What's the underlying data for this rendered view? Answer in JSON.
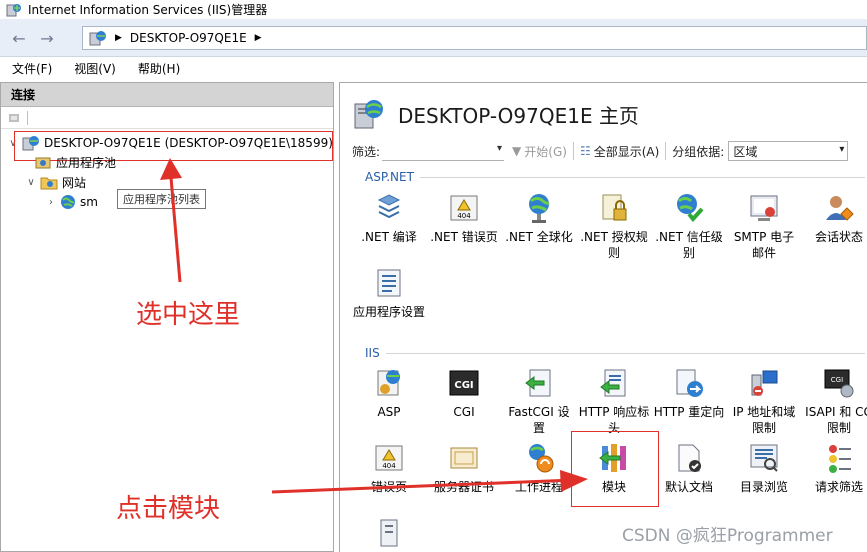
{
  "window": {
    "title": "Internet Information Services (IIS)管理器"
  },
  "address": {
    "crumbs": [
      "DESKTOP-O97QE1E"
    ]
  },
  "menu": {
    "items": [
      "文件(F)",
      "视图(V)",
      "帮助(H)"
    ]
  },
  "connections": {
    "header": "连接",
    "tree": {
      "server": "DESKTOP-O97QE1E (DESKTOP-O97QE1E\\18599)",
      "app_pools": "应用程序池",
      "sites": "网站",
      "site_sm": "sm"
    },
    "tooltip": "应用程序池列表"
  },
  "main": {
    "title": "DESKTOP-O97QE1E 主页",
    "filter": {
      "label": "筛选:",
      "start": "开始(G)",
      "show_all": "全部显示(A)",
      "group_label": "分组依据:",
      "group_value": "区域"
    },
    "sections": {
      "aspnet": "ASP.NET",
      "iis": "IIS"
    },
    "aspnet_tiles": [
      {
        "label": ".NET 编译",
        "icon": "dotnet-compile-icon"
      },
      {
        "label": ".NET 错误页",
        "icon": "error-404-icon"
      },
      {
        "label": ".NET 全球化",
        "icon": "globe-icon"
      },
      {
        "label": ".NET 授权规则",
        "icon": "lock-icon"
      },
      {
        "label": ".NET 信任级别",
        "icon": "trust-check-icon"
      },
      {
        "label": "SMTP 电子邮件",
        "icon": "email-icon"
      },
      {
        "label": "会话状态",
        "icon": "session-user-icon"
      },
      {
        "label": "应用程序设置",
        "icon": "app-settings-icon"
      }
    ],
    "iis_tiles": [
      {
        "label": "ASP",
        "icon": "asp-icon"
      },
      {
        "label": "CGI",
        "icon": "cgi-icon"
      },
      {
        "label": "FastCGI 设置",
        "icon": "fastcgi-icon"
      },
      {
        "label": "HTTP 响应标头",
        "icon": "http-headers-icon"
      },
      {
        "label": "HTTP 重定向",
        "icon": "http-redirect-icon"
      },
      {
        "label": "IP 地址和域限制",
        "icon": "ip-restrict-icon"
      },
      {
        "label": "ISAPI 和 CG限制",
        "icon": "isapi-icon"
      },
      {
        "label": "错误页",
        "icon": "error-page-icon"
      },
      {
        "label": "服务器证书",
        "icon": "certificate-icon"
      },
      {
        "label": "工作进程",
        "icon": "worker-process-icon"
      },
      {
        "label": "模块",
        "icon": "modules-icon"
      },
      {
        "label": "默认文档",
        "icon": "default-doc-icon"
      },
      {
        "label": "目录浏览",
        "icon": "dir-browse-icon"
      },
      {
        "label": "请求筛选",
        "icon": "request-filter-icon"
      }
    ]
  },
  "annotations": {
    "select_here": "选中这里",
    "click_modules": "点击模块",
    "watermark": "CSDN @疯狂Programmer"
  },
  "colors": {
    "accent_red": "#e0302a",
    "section_blue": "#2a5ea8"
  }
}
